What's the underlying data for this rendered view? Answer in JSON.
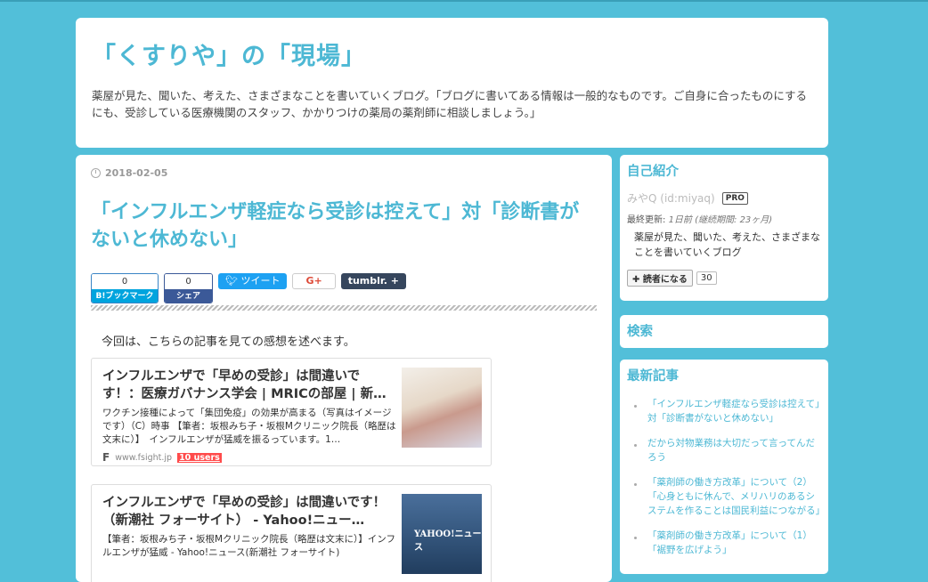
{
  "blog": {
    "title": "「くすりや」の「現場」",
    "description": "薬屋が見た、聞いた、考えた、さまざまなことを書いていくブログ。「ブログに書いてある情報は一般的なものです。ご自身に合ったものにするにも、受診している医療機関のスタッフ、かかりつけの薬局の薬剤師に相談しましょう。」"
  },
  "entry": {
    "date": "2018-02-05",
    "title": "「インフルエンザ軽症なら受診は控えて」対「診断書がないと休めない」",
    "lead": "今回は、こちらの記事を見ての感想を述べます。"
  },
  "share": {
    "hatena_count": "0",
    "hatena_label": "B!ブックマーク",
    "facebook_count": "0",
    "facebook_label": "シェア",
    "tweet_label": "ツイート",
    "gplus_label": "G+",
    "tumblr_label": "tumblr.  +"
  },
  "embeds": [
    {
      "title": "インフルエンザで「早めの受診」は間違いです！：医療ガバナンス学会 | MRICの部屋 | 新…",
      "snippet": "ワクチン接種によって「集団免疫」の効果が高まる（写真はイメージです）（C）時事 【筆者：坂根みち子・坂根Mクリニック院長（略歴は文末に）】　インフルエンザが猛威を振るっています。1…",
      "favicon": "F",
      "domain": "www.fsight.jp",
      "users": "10 users"
    },
    {
      "title": "インフルエンザで「早めの受診」は間違いです！（新潮社 フォーサイト） - Yahoo!ニュー…",
      "snippet": "【筆者：坂根みち子・坂根Mクリニック院長（略歴は文末に）】インフルエンザが猛威 - Yahoo!ニュース(新潮社 フォーサイト)",
      "thumb_text": "YAHOO!ニュース"
    }
  ],
  "sidebar": {
    "profile": {
      "heading": "自己紹介",
      "name": "みやQ (id:miyaq)",
      "badge": "PRO",
      "updated_label": "最終更新: ",
      "updated_value": "1日前",
      "period": "(継続期間: 23ヶ月)",
      "description": "薬屋が見た、聞いた、考えた、さまざまなことを書いていくブログ",
      "subscribe_label": "✚ 読者になる",
      "subscribers": "30"
    },
    "search_heading": "検索",
    "recent": {
      "heading": "最新記事",
      "items": [
        "「インフルエンザ軽症なら受診は控えて」対「診断書がないと休めない」",
        "だから対物業務は大切だって言ってんだろう",
        "「薬剤師の働き方改革」について（2）「心身ともに休んで、メリハリのあるシステムを作ることは国民利益につながる」",
        "「薬剤師の働き方改革」について（1）「裾野を広げよう」"
      ]
    }
  }
}
